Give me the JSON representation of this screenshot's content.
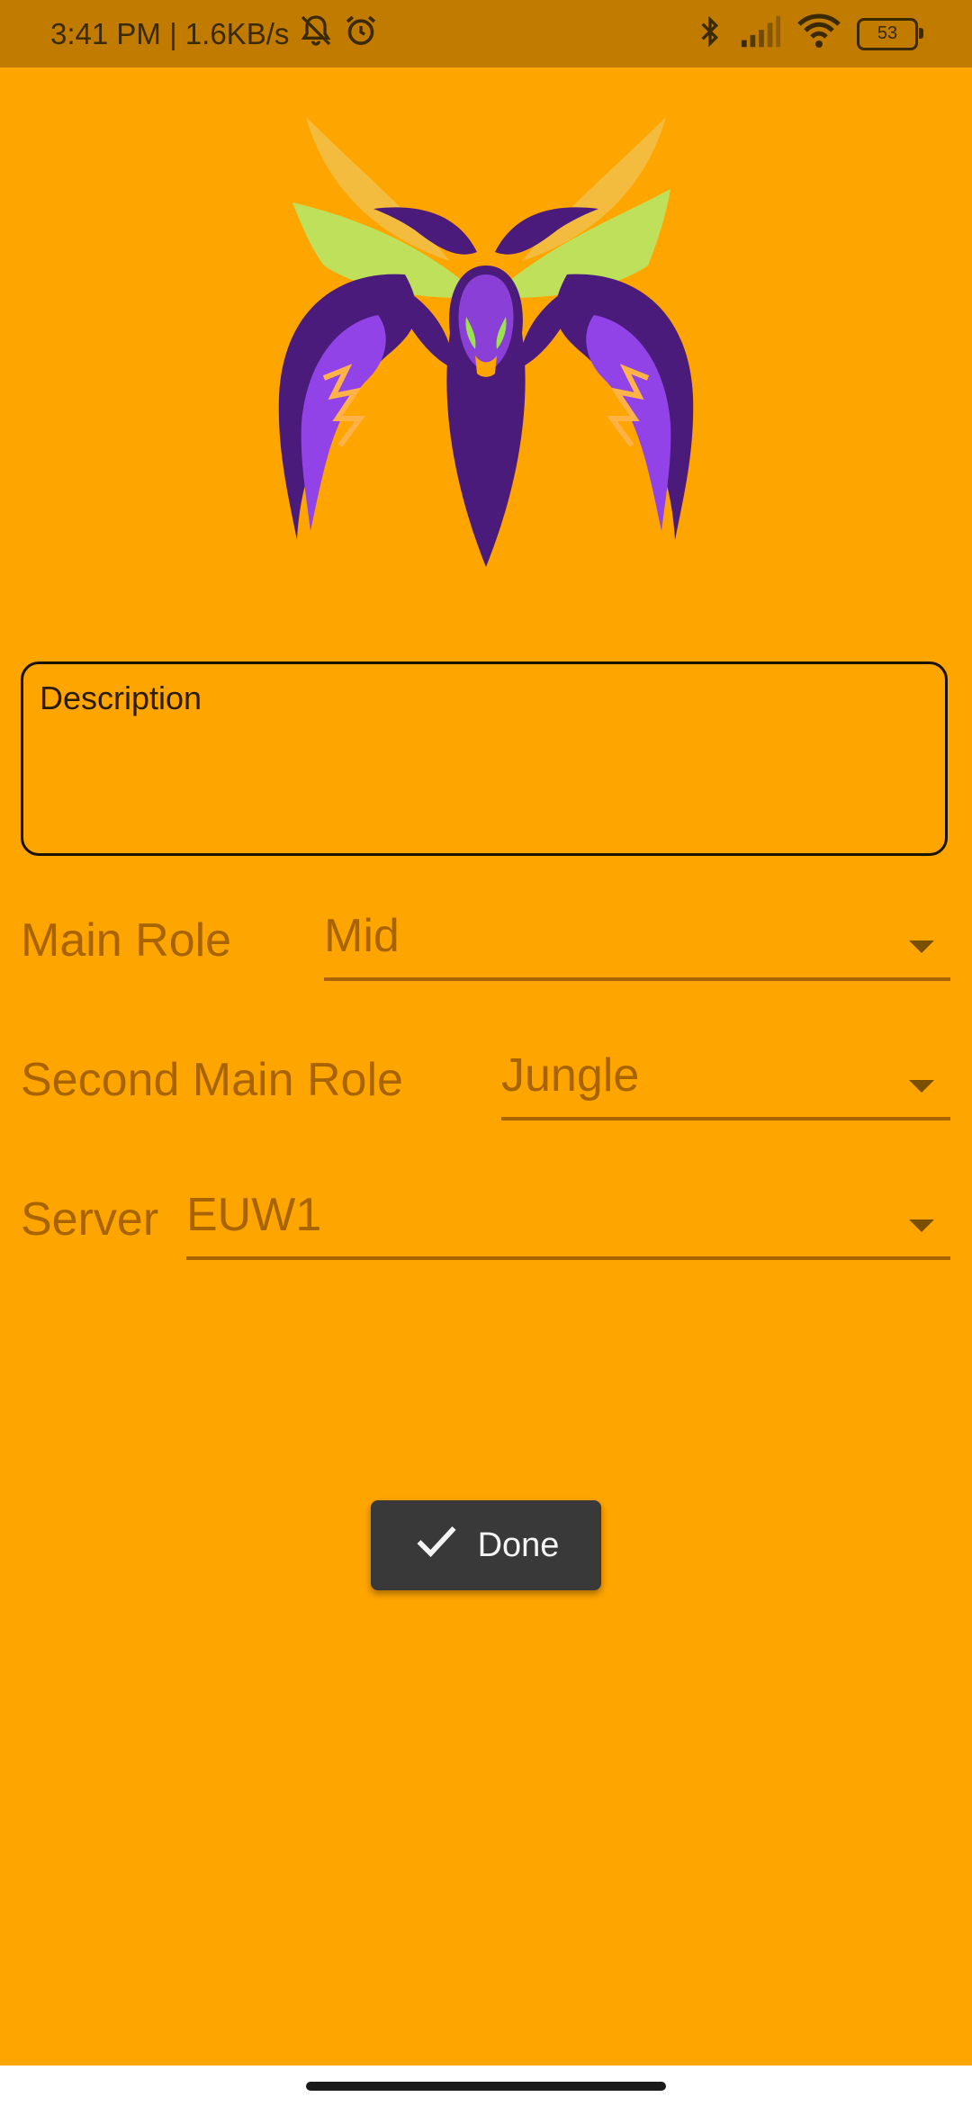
{
  "status_bar": {
    "time_and_speed": "3:41 PM | 1.6KB/s",
    "battery_level": "53",
    "icons": [
      "bell-off-icon",
      "alarm-icon",
      "bluetooth-icon",
      "signal-icon",
      "wifi-icon",
      "battery-icon"
    ]
  },
  "form": {
    "description_label": "Description",
    "main_role_label": "Main Role",
    "main_role_value": "Mid",
    "second_role_label": "Second Main Role",
    "second_role_value": "Jungle",
    "server_label": "Server",
    "server_value": "EUW1"
  },
  "done_button": {
    "label": "Done",
    "icon": "check-icon"
  },
  "colors": {
    "background": "#FFA500",
    "status_bar": "#C17C00",
    "muted_text": "#a86400",
    "button": "#383938"
  }
}
